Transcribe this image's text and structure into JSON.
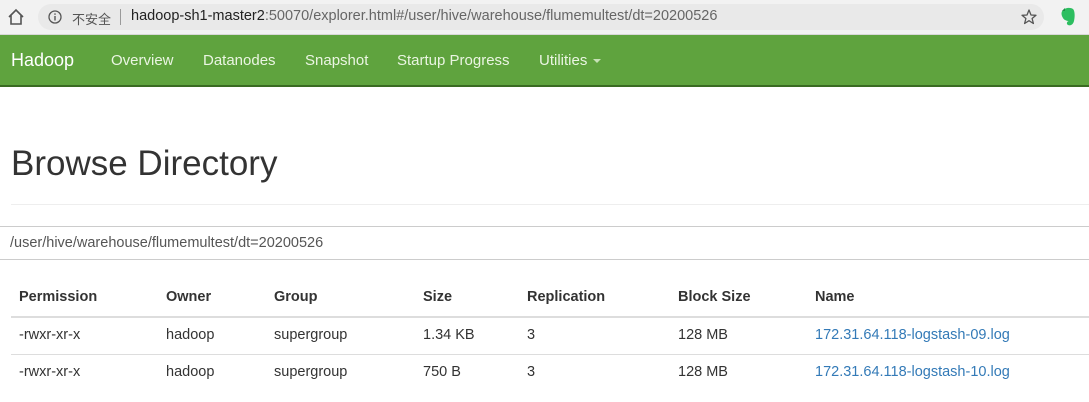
{
  "browser": {
    "insecure_label": "不安全",
    "url_host": "hadoop-sh1-master2",
    "url_rest": ":50070/explorer.html#/user/hive/warehouse/flumemultest/dt=20200526"
  },
  "navbar": {
    "brand": "Hadoop",
    "items": [
      "Overview",
      "Datanodes",
      "Snapshot",
      "Startup Progress",
      "Utilities"
    ],
    "color": "#5fa33e"
  },
  "page": {
    "title": "Browse Directory",
    "path": "/user/hive/warehouse/flumemultest/dt=20200526"
  },
  "table": {
    "headers": [
      "Permission",
      "Owner",
      "Group",
      "Size",
      "Replication",
      "Block Size",
      "Name"
    ],
    "rows": [
      [
        "-rwxr-xr-x",
        "hadoop",
        "supergroup",
        "1.34 KB",
        "3",
        "128 MB",
        "172.31.64.118-logstash-09.log"
      ],
      [
        "-rwxr-xr-x",
        "hadoop",
        "supergroup",
        "750 B",
        "3",
        "128 MB",
        "172.31.64.118-logstash-10.log"
      ]
    ]
  }
}
